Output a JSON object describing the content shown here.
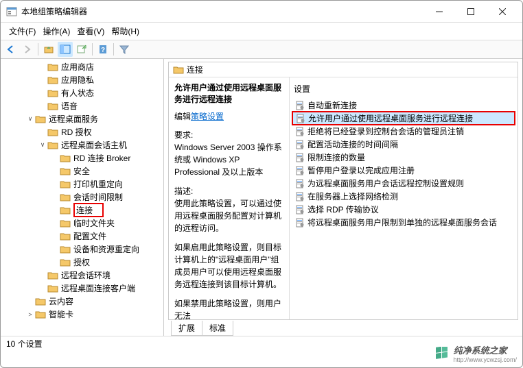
{
  "window": {
    "title": "本地组策略编辑器"
  },
  "menu": {
    "file": "文件(F)",
    "action": "操作(A)",
    "view": "查看(V)",
    "help": "帮助(H)"
  },
  "tree": {
    "items": [
      {
        "indent": 3,
        "expander": "",
        "label": "应用商店"
      },
      {
        "indent": 3,
        "expander": "",
        "label": "应用隐私"
      },
      {
        "indent": 3,
        "expander": "",
        "label": "有人状态"
      },
      {
        "indent": 3,
        "expander": "",
        "label": "语音"
      },
      {
        "indent": 2,
        "expander": "∨",
        "label": "远程桌面服务"
      },
      {
        "indent": 3,
        "expander": "",
        "label": "RD 授权"
      },
      {
        "indent": 3,
        "expander": "∨",
        "label": "远程桌面会话主机"
      },
      {
        "indent": 4,
        "expander": "",
        "label": "RD 连接 Broker"
      },
      {
        "indent": 4,
        "expander": "",
        "label": "安全"
      },
      {
        "indent": 4,
        "expander": "",
        "label": "打印机重定向"
      },
      {
        "indent": 4,
        "expander": "",
        "label": "会话时间限制"
      },
      {
        "indent": 4,
        "expander": "",
        "label": "连接",
        "highlight": true
      },
      {
        "indent": 4,
        "expander": "",
        "label": "临时文件夹"
      },
      {
        "indent": 4,
        "expander": "",
        "label": "配置文件"
      },
      {
        "indent": 4,
        "expander": "",
        "label": "设备和资源重定向"
      },
      {
        "indent": 4,
        "expander": "",
        "label": "授权"
      },
      {
        "indent": 3,
        "expander": "",
        "label": "远程会话环境"
      },
      {
        "indent": 3,
        "expander": "",
        "label": "远程桌面连接客户端"
      },
      {
        "indent": 2,
        "expander": "",
        "label": "云内容"
      },
      {
        "indent": 2,
        "expander": ">",
        "label": "智能卡"
      }
    ]
  },
  "detail": {
    "header": "连接",
    "title": "允许用户通过使用远程桌面服务进行远程连接",
    "edit_prefix": "编辑",
    "edit_link": "策略设置",
    "req_label": "要求:",
    "req_text": "Windows Server 2003 操作系统或 Windows XP Professional 及以上版本",
    "desc_label": "描述:",
    "desc_text": "使用此策略设置，可以通过使用远程桌面服务配置对计算机的远程访问。",
    "para2": "如果启用此策略设置，则目标计算机上的\"远程桌面用户\"组成员用户可以使用远程桌面服务远程连接到该目标计算机。",
    "para3": "如果禁用此策略设置，则用户无法"
  },
  "settings": {
    "col_header": "设置",
    "rows": [
      {
        "label": "自动重新连接"
      },
      {
        "label": "允许用户通过使用远程桌面服务进行远程连接",
        "selected": true,
        "highlight": true
      },
      {
        "label": "拒绝将已经登录到控制台会话的管理员注销"
      },
      {
        "label": "配置活动连接的时间间隔"
      },
      {
        "label": "限制连接的数量"
      },
      {
        "label": "暂停用户登录以完成应用注册"
      },
      {
        "label": "为远程桌面服务用户会话远程控制设置规则"
      },
      {
        "label": "在服务器上选择网络检测"
      },
      {
        "label": "选择 RDP 传输协议"
      },
      {
        "label": "将远程桌面服务用户限制到单独的远程桌面服务会话"
      }
    ]
  },
  "tabs": {
    "extended": "扩展",
    "standard": "标准"
  },
  "statusbar": "10 个设置",
  "watermark": {
    "text": "纯净系统之家",
    "url": "http://www.ycwzsj.com/"
  }
}
